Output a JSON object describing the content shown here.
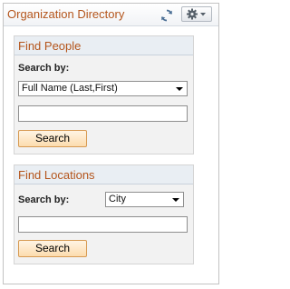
{
  "pagelet": {
    "title": "Organization Directory",
    "refresh_icon": "refresh-icon",
    "options_icon": "gear-icon"
  },
  "find_people": {
    "title": "Find People",
    "search_by_label": "Search by:",
    "search_by_value": "Full Name (Last,First)",
    "search_input_value": "",
    "search_button": "Search"
  },
  "find_locations": {
    "title": "Find Locations",
    "search_by_label": "Search by:",
    "search_by_value": "City",
    "search_input_value": "",
    "search_button": "Search"
  },
  "colors": {
    "title": "#b4551c",
    "button_bg": "#fcdcae",
    "button_border": "#d79a52",
    "group_bg": "#f2f2f2",
    "group_header_bg": "#e9eef3"
  }
}
